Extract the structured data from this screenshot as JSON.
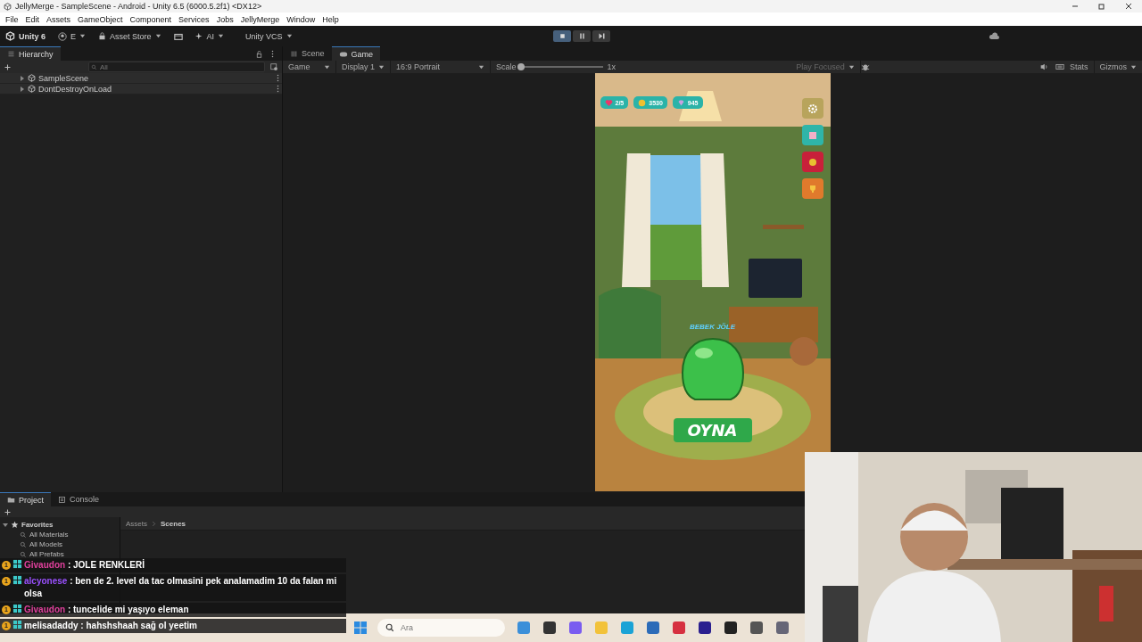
{
  "window": {
    "title": "JellyMerge - SampleScene - Android - Unity 6.5 (6000.5.2f1) <DX12>"
  },
  "menu": [
    "File",
    "Edit",
    "Assets",
    "GameObject",
    "Component",
    "Services",
    "Jobs",
    "JellyMerge",
    "Window",
    "Help"
  ],
  "toolbar": {
    "product": "Unity 6",
    "account": "E",
    "asset_store": "Asset Store",
    "ai": "AI",
    "vcs": "Unity VCS",
    "play_controls": [
      {
        "kind": "stop",
        "on": true
      },
      {
        "kind": "pause",
        "on": false
      },
      {
        "kind": "step",
        "on": false
      }
    ]
  },
  "hierarchy": {
    "tab": "Hierarchy",
    "search_placeholder": "All",
    "items": [
      {
        "label": "SampleScene",
        "expanded": false
      },
      {
        "label": "DontDestroyOnLoad",
        "expanded": false
      }
    ]
  },
  "view_tabs": [
    {
      "label": "Scene",
      "selected": false
    },
    {
      "label": "Game",
      "selected": true
    }
  ],
  "game_toolbar": {
    "mode": "Game",
    "display": "Display 1",
    "aspect": "16:9 Portrait",
    "scale_label": "Scale",
    "scale": {
      "level": 0
    },
    "zoom": "1x",
    "play_focus": "Play Focused",
    "stats": "Stats",
    "gizmos": "Gizmos"
  },
  "game": {
    "hud": [
      {
        "kind": "lives",
        "value": "2/5"
      },
      {
        "kind": "coins",
        "value": "3530"
      },
      {
        "kind": "gems",
        "value": "945"
      }
    ],
    "side_buttons": [
      {
        "kind": "settings",
        "color": "#b8a45c"
      },
      {
        "kind": "shop",
        "color": "#2fb5a9"
      },
      {
        "kind": "gift",
        "color": "#c8203a"
      },
      {
        "kind": "trophy",
        "color": "#e07a2c"
      }
    ],
    "character_name": "BEBEK JÖLE",
    "play_button": "OYNA"
  },
  "bottom_tabs": [
    {
      "label": "Project",
      "selected": true
    },
    {
      "label": "Console",
      "selected": false
    }
  ],
  "project": {
    "favorites": {
      "label": "Favorites",
      "expanded": true,
      "children": [
        "All Materials",
        "All Models",
        "All Prefabs"
      ]
    },
    "breadcrumb": [
      "Assets",
      "Scenes"
    ]
  },
  "taskbar": {
    "search_placeholder": "Ara"
  },
  "chat": [
    {
      "badge": "1",
      "user": "Givaudon",
      "color": "#e0409c",
      "text": " : JOLE RENKLERİ"
    },
    {
      "badge": "1",
      "user": "alcyonese",
      "color": "#9a50ff",
      "text": " : ben de 2. level da tac olmasini pek analamadim 10 da falan mi olsa"
    },
    {
      "badge": "1",
      "user": "Givaudon",
      "color": "#e0409c",
      "text": " : tuncelide mi yaşıyo eleman"
    },
    {
      "badge": "1",
      "user": "melisadaddy",
      "color": "#ffffff",
      "text": " : hahshshaah sağ ol yeetim"
    }
  ]
}
